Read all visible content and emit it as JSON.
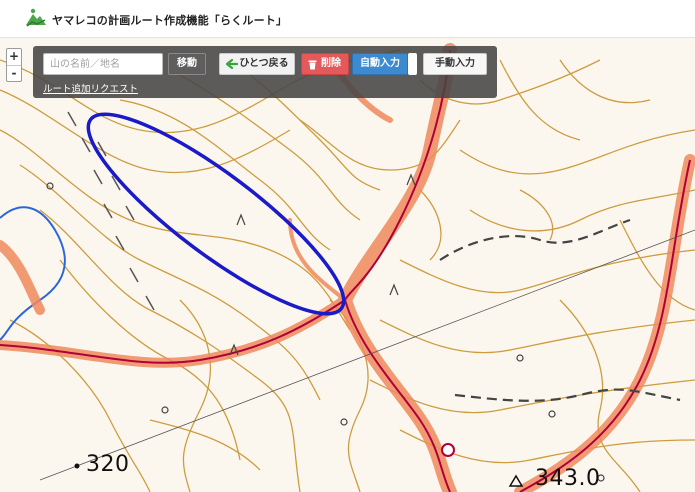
{
  "header": {
    "title": "ヤマレコの計画ルート作成機能「らくルート」",
    "logo_icon": "mountain-route-icon",
    "logo_color": "#4aa84a"
  },
  "map": {
    "zoom": {
      "in_label": "+",
      "out_label": "-"
    },
    "elevation_labels": {
      "west": "320",
      "east": "343.0"
    },
    "colors": {
      "background": "#fcf7ee",
      "contour": "#c9932e",
      "route_highlight": "#f08a5d",
      "route_line": "#b0003a",
      "ellipse": "#1a1ac8",
      "water": "#2b66d9"
    }
  },
  "toolbar": {
    "search_placeholder": "山の名前／地名",
    "move_label": "移動",
    "back_label": "ひとつ戻る",
    "delete_label": "削除",
    "auto_label": "自動入力",
    "manual_label": "手動入力",
    "route_request_link": "ルート追加リクエスト",
    "back_icon": "green-arrow-left-icon",
    "delete_icon": "trash-icon",
    "colors": {
      "auto": "#3d8ad0",
      "delete": "#e45a5a",
      "panel": "#464646"
    }
  }
}
